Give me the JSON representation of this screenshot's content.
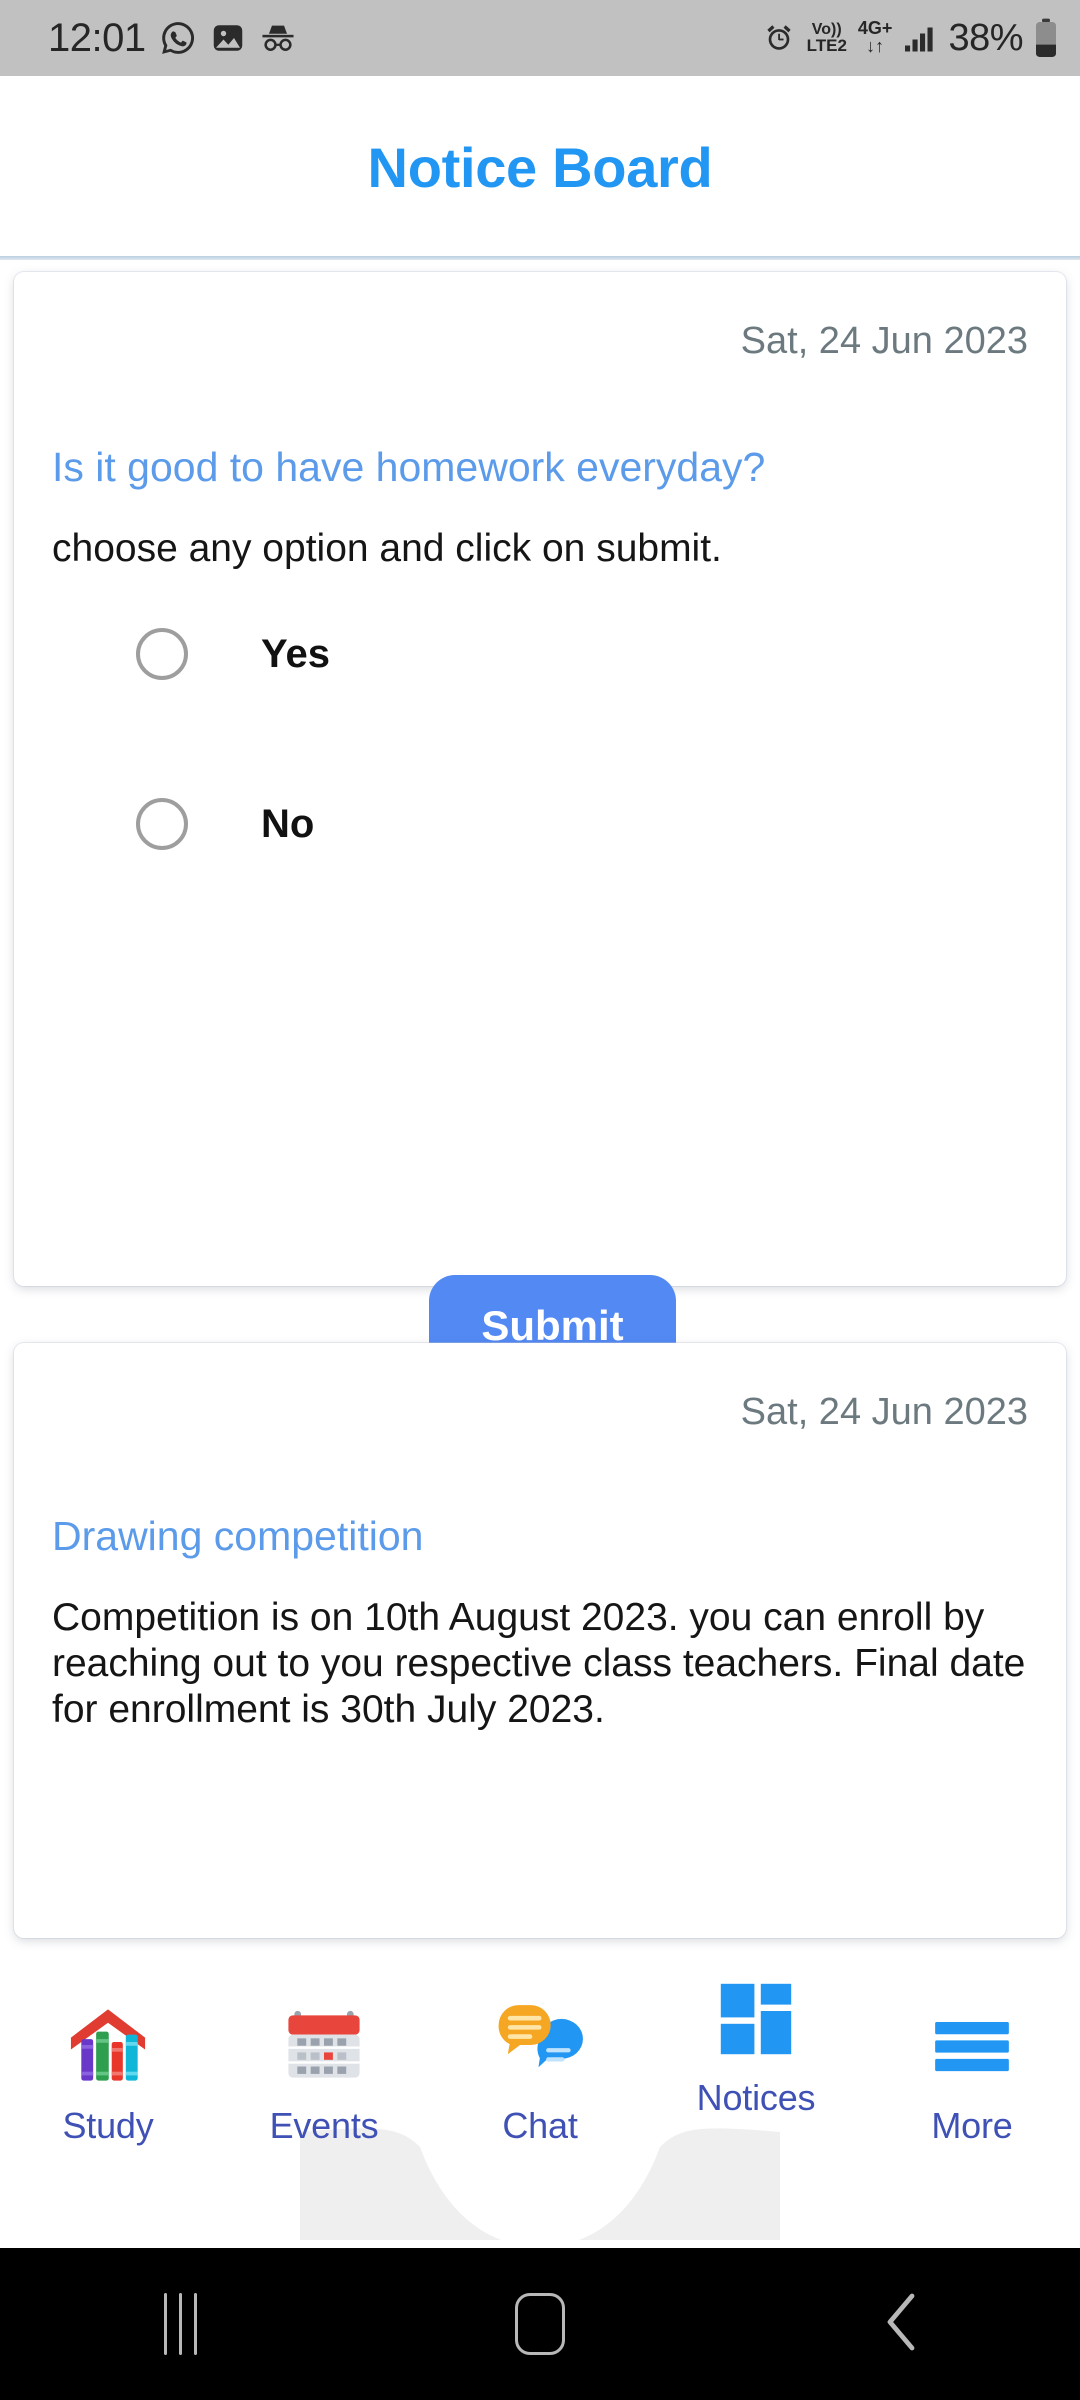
{
  "status_bar": {
    "time": "12:01",
    "battery_percent": "38%",
    "network_line1": "Vo))",
    "network_line2": "LTE2",
    "network_gen": "4G+",
    "data_arrows": "↓↑",
    "icons": [
      "whatsapp-icon",
      "gallery-icon",
      "incognito-icon",
      "alarm-icon",
      "signal-icon",
      "battery-icon"
    ]
  },
  "header": {
    "title": "Notice Board",
    "title_color": "#2196f3"
  },
  "notices": [
    {
      "date": "Sat, 24 Jun 2023",
      "title": "Is it good to have homework everyday?",
      "body": "choose any option and click on submit.",
      "options": [
        {
          "label": "Yes",
          "selected": false
        },
        {
          "label": "No",
          "selected": false
        }
      ],
      "submit_label": "Submit",
      "submit_color": "#5289f3"
    },
    {
      "date": "Sat, 24 Jun 2023",
      "title": "Drawing competition",
      "body": "Competition is on 10th August 2023.  you can enroll by reaching out to you respective  class teachers. Final date for enrollment is 30th July 2023."
    }
  ],
  "bottom_nav": {
    "active_index": 3,
    "label_color": "#3f51b5",
    "items": [
      {
        "label": "Study",
        "icon": "study-books-house-icon"
      },
      {
        "label": "Events",
        "icon": "calendar-icon"
      },
      {
        "label": "Chat",
        "icon": "chat-bubbles-icon"
      },
      {
        "label": "Notices",
        "icon": "grid-blocks-icon"
      },
      {
        "label": "More",
        "icon": "hamburger-menu-icon"
      }
    ]
  },
  "android_nav": {
    "recents": "recents-button",
    "home": "home-button",
    "back": "back-button"
  }
}
